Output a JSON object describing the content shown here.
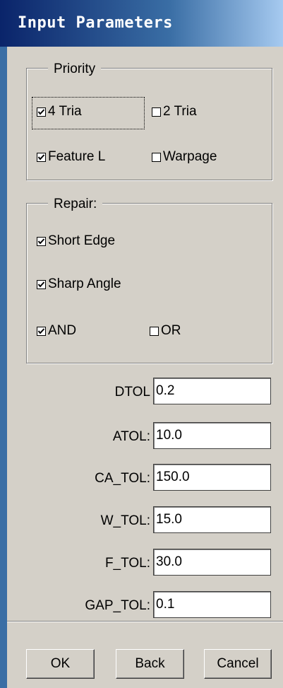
{
  "window": {
    "title": "Input Parameters"
  },
  "priority": {
    "legend": "Priority",
    "options": [
      {
        "label": "4 Tria",
        "checked": true
      },
      {
        "label": "2 Tria",
        "checked": false
      },
      {
        "label": "Feature L",
        "checked": true
      },
      {
        "label": "Warpage",
        "checked": false
      }
    ]
  },
  "repair": {
    "legend": "Repair:",
    "options": [
      {
        "label": "Short Edge",
        "checked": true
      },
      {
        "label": "Sharp Angle",
        "checked": true
      },
      {
        "label": "AND",
        "checked": true
      },
      {
        "label": "OR",
        "checked": false
      }
    ]
  },
  "parameters": [
    {
      "label": "DTOL",
      "value": "0.2"
    },
    {
      "label": "ATOL:",
      "value": "10.0"
    },
    {
      "label": "CA_TOL:",
      "value": "150.0"
    },
    {
      "label": "W_TOL:",
      "value": "15.0"
    },
    {
      "label": "F_TOL:",
      "value": "30.0"
    },
    {
      "label": "GAP_TOL:",
      "value": "0.1"
    }
  ],
  "buttons": {
    "ok": "OK",
    "back": "Back",
    "cancel": "Cancel"
  }
}
